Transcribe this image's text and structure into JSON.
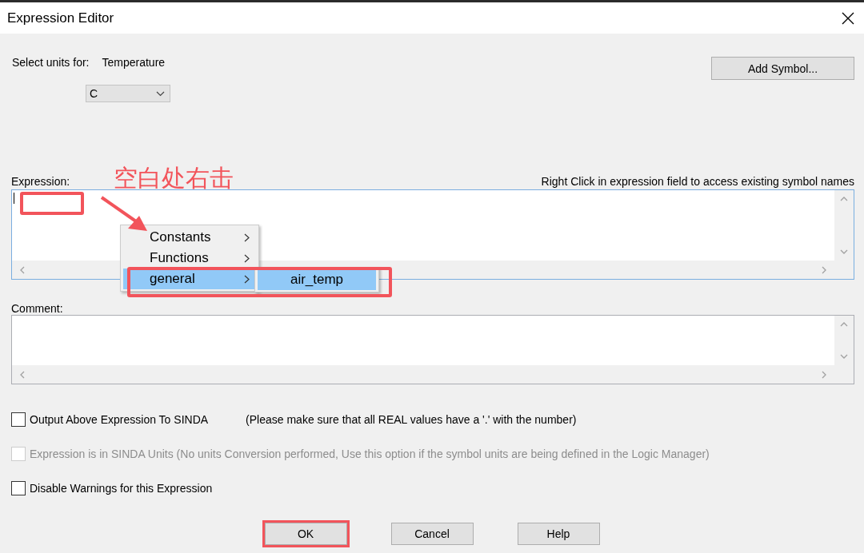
{
  "window": {
    "title": "Expression Editor"
  },
  "units": {
    "label": "Select units for:",
    "quantity": "Temperature",
    "value": "C"
  },
  "add_symbol_button": "Add Symbol...",
  "annotation": {
    "text": "空白处右击"
  },
  "expression": {
    "label": "Expression:",
    "hint": "Right Click in expression field to access existing symbol names"
  },
  "context_menu": {
    "items": [
      {
        "label": "Constants",
        "selected": false
      },
      {
        "label": "Functions",
        "selected": false
      },
      {
        "label": "general",
        "selected": true
      }
    ],
    "submenu": [
      {
        "label": "air_temp",
        "selected": true
      }
    ]
  },
  "comment": {
    "label": "Comment:"
  },
  "options": [
    {
      "label": "Output Above Expression To SINDA",
      "note": "(Please make sure that all REAL values have a '.' with the number)",
      "checked": false,
      "disabled": false
    },
    {
      "label": "Expression is in SINDA Units (No units Conversion performed, Use this option if the symbol units are being defined in the Logic Manager)",
      "checked": false,
      "disabled": true
    },
    {
      "label": "Disable Warnings for this Expression",
      "checked": false,
      "disabled": false
    }
  ],
  "buttons": [
    {
      "label": "OK",
      "marked": true
    },
    {
      "label": "Cancel",
      "marked": false
    },
    {
      "label": "Help",
      "marked": false
    }
  ]
}
